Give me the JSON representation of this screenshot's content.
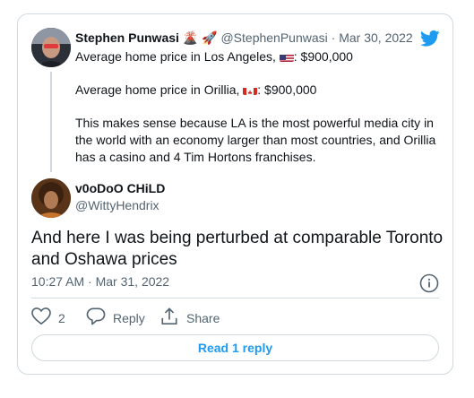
{
  "colors": {
    "accent": "#1d9bf0",
    "muted": "#536471",
    "border": "#cfd9de"
  },
  "parent": {
    "name": "Stephen Punwasi",
    "name_emoji": [
      "volcano-emoji",
      "rocket-emoji"
    ],
    "handle": "@StephenPunwasi",
    "date": "Mar 30, 2022",
    "line1_prefix": "Average home price in Los Angeles,",
    "line1_value": ": $900,000",
    "line2_prefix": "Average home price in Orillia,",
    "line2_value": ": $900,000",
    "paragraph": "This makes sense because LA is the most powerful media city in the world with an economy larger than most countries, and Orillia has a casino and 4 Tim Hortons franchises."
  },
  "reply": {
    "name": "v0oDoO CHiLD",
    "handle": "@WittyHendrix",
    "text": "And here I was being perturbed at comparable Toronto and Oshawa prices",
    "timestamp": "10:27 AM · Mar 31, 2022"
  },
  "actions": {
    "likes": "2",
    "reply_label": "Reply",
    "share_label": "Share"
  },
  "read_replies_label": "Read 1 reply"
}
